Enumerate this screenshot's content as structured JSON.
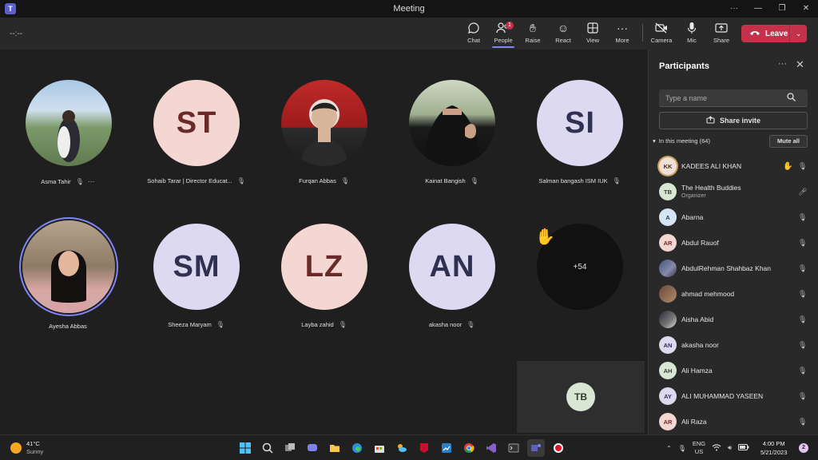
{
  "window": {
    "title": "Meeting"
  },
  "toolbar": {
    "timer": "--:--",
    "buttons": {
      "chat": "Chat",
      "people": "People",
      "people_badge": "1",
      "raise": "Raise",
      "react": "React",
      "view": "View",
      "more": "More",
      "camera": "Camera",
      "mic": "Mic",
      "share": "Share"
    },
    "leave": "Leave"
  },
  "stage": {
    "tiles": [
      {
        "name": "Asma Tahir",
        "type": "photo"
      },
      {
        "name": "Sohaib Tarar | Director Educat...",
        "initials": "ST"
      },
      {
        "name": "Furqan Abbas",
        "type": "photo"
      },
      {
        "name": "Kainat Bangish",
        "type": "photo"
      },
      {
        "name": "Salman bangash ISM IUK",
        "initials": "SI"
      },
      {
        "name": "Ayesha Abbas",
        "type": "photo"
      },
      {
        "name": "Sheeza Maryam",
        "initials": "SM"
      },
      {
        "name": "Layba zahid",
        "initials": "LZ"
      },
      {
        "name": "akasha noor",
        "initials": "AN"
      }
    ],
    "overflow": "+54",
    "self_view": {
      "initials": "TB"
    }
  },
  "panel": {
    "title": "Participants",
    "search_placeholder": "Type a name",
    "share_invite": "Share invite",
    "section": "In this meeting (64)",
    "mute_all": "Mute all",
    "participants": [
      {
        "initials": "KK",
        "name": "KADEES ALI KHAN"
      },
      {
        "initials": "TB",
        "name": "The Health Buddies",
        "role": "Organizer"
      },
      {
        "initials": "A",
        "name": "Abarna"
      },
      {
        "initials": "AR",
        "name": "Abdul Rauof"
      },
      {
        "initials": "",
        "name": "AbdulRehman Shahbaz Khan"
      },
      {
        "initials": "",
        "name": "ahmad mehmood"
      },
      {
        "initials": "",
        "name": "Aisha Abid"
      },
      {
        "initials": "AN",
        "name": "akasha noor"
      },
      {
        "initials": "AH",
        "name": "Ali Hamza"
      },
      {
        "initials": "AY",
        "name": "ALI MUHAMMAD YASEEN"
      },
      {
        "initials": "AR",
        "name": "Ali Raza"
      }
    ]
  },
  "taskbar": {
    "weather_temp": "41°C",
    "weather_desc": "Sunny",
    "lang_line1": "ENG",
    "lang_line2": "US",
    "time": "4:00 PM",
    "date": "5/21/2023",
    "notifications": "2"
  }
}
